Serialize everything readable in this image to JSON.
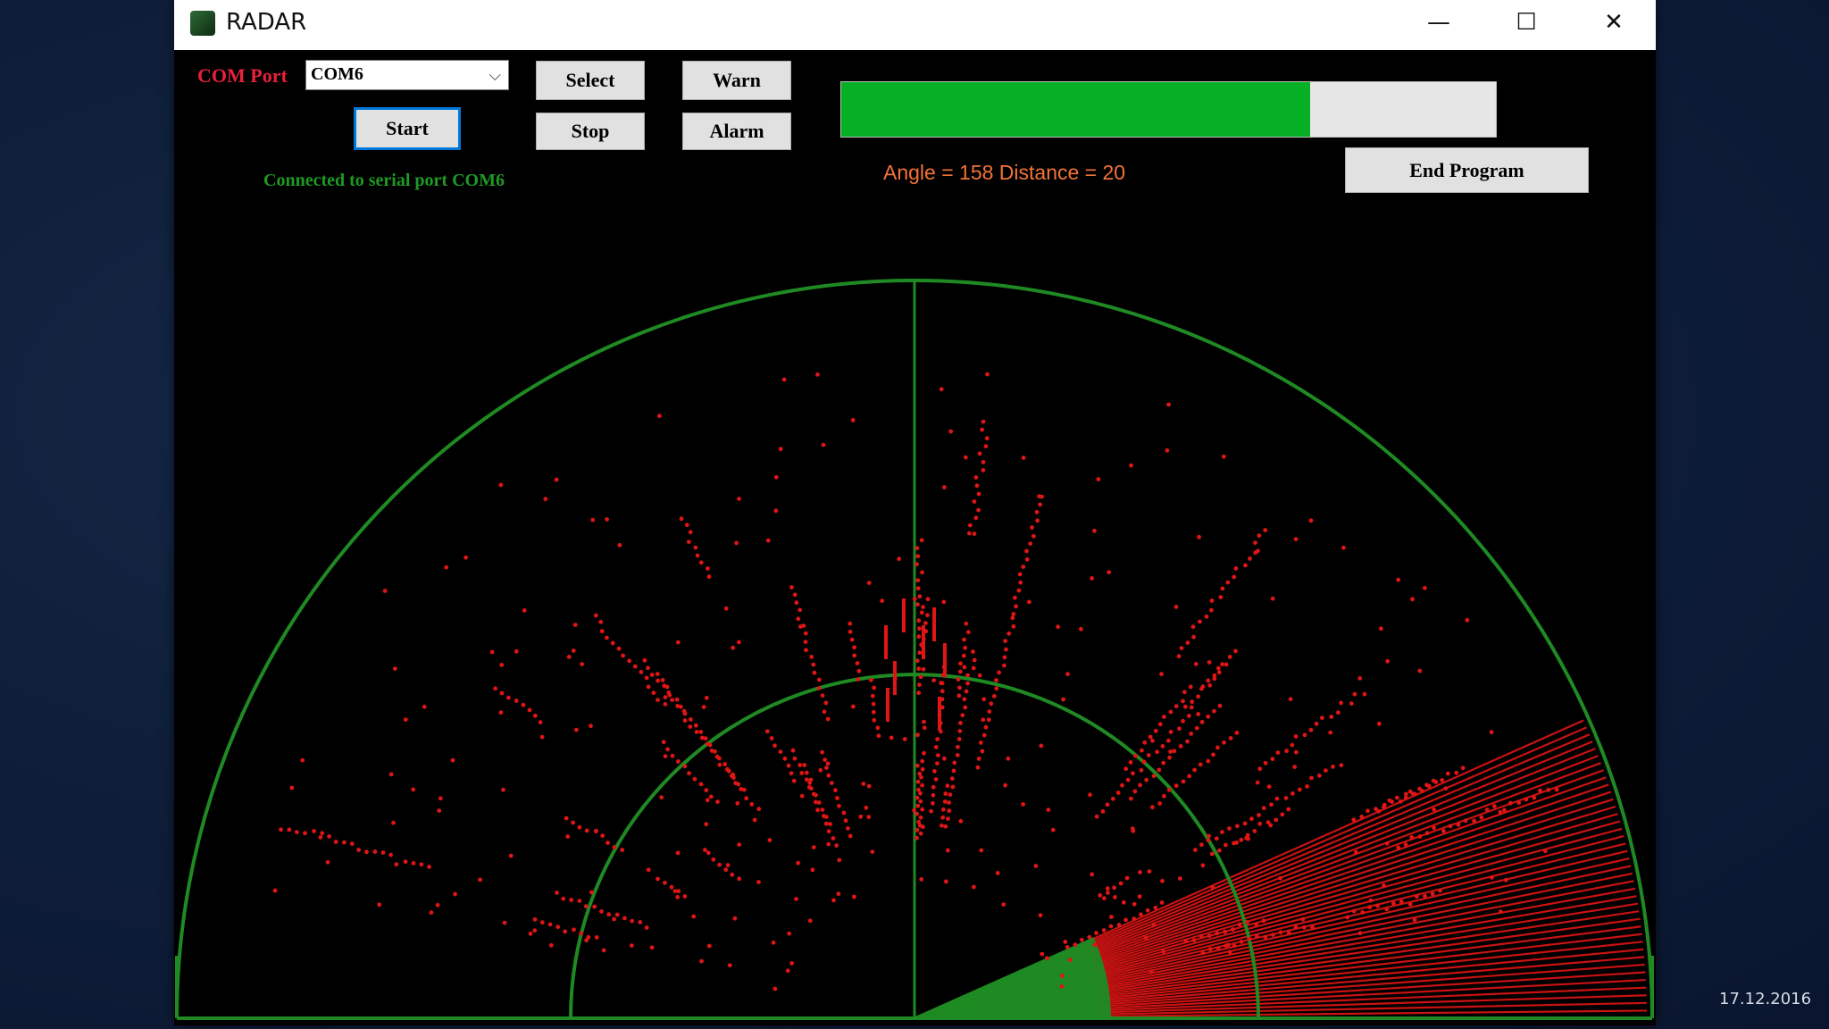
{
  "window": {
    "title": "RADAR",
    "controls": {
      "minimize": "—",
      "maximize": "☐",
      "close": "✕"
    }
  },
  "controls": {
    "com_port_label": "COM Port",
    "com_port_value": "COM6",
    "dropdown_arrow": "⌵",
    "select_label": "Select",
    "warn_label": "Warn",
    "start_label": "Start",
    "stop_label": "Stop",
    "alarm_label": "Alarm",
    "end_program_label": "End Program"
  },
  "status_text": "Connected to serial port COM6",
  "progress": {
    "fraction": 0.716
  },
  "readout": {
    "text": "Angle = 158 Distance = 20",
    "angle": 158,
    "distance": 20
  },
  "radar": {
    "sweep_from_deg": 156,
    "sweep_to_deg": 180,
    "colors": {
      "grid": "#1f8a23",
      "detection": "#e01515",
      "sweep_green": "#1f8a23"
    }
  },
  "footer": {
    "date": "17.12.2016"
  }
}
